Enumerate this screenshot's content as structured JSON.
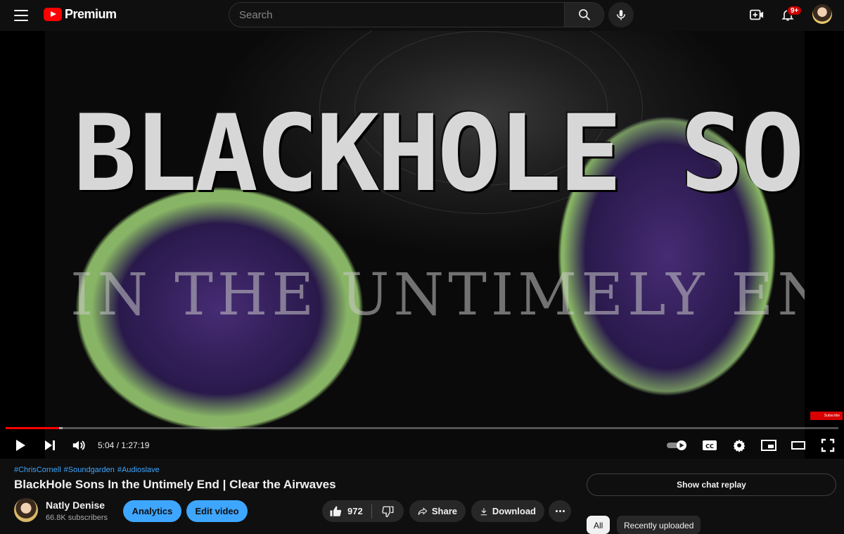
{
  "header": {
    "logo_text": "Premium",
    "search_placeholder": "Search",
    "notification_badge": "9+"
  },
  "video": {
    "overlay_title": "BLACKHOLE SONS",
    "overlay_subtitle": "IN THE UNTIMELY END",
    "subscribe_chip": "Subscribe",
    "progress_played_fraction": 0.0646,
    "progress_buffered_fraction": 0.068
  },
  "player_controls": {
    "current_time": "5:04",
    "duration": "1:27:19",
    "time_display": "5:04 / 1:27:19"
  },
  "info": {
    "hashtags": [
      "#ChrisCornell",
      "#Soundgarden",
      "#Audioslave"
    ],
    "title": "BlackHole Sons In the Untimely End | Clear the Airwaves",
    "channel_name": "Natly Denise",
    "subscribers": "66.8K subscribers",
    "analytics_label": "Analytics",
    "edit_video_label": "Edit video",
    "like_count": "972",
    "share_label": "Share",
    "download_label": "Download",
    "chat_replay_label": "Show chat replay",
    "chips": [
      "All",
      "Recently uploaded"
    ]
  }
}
